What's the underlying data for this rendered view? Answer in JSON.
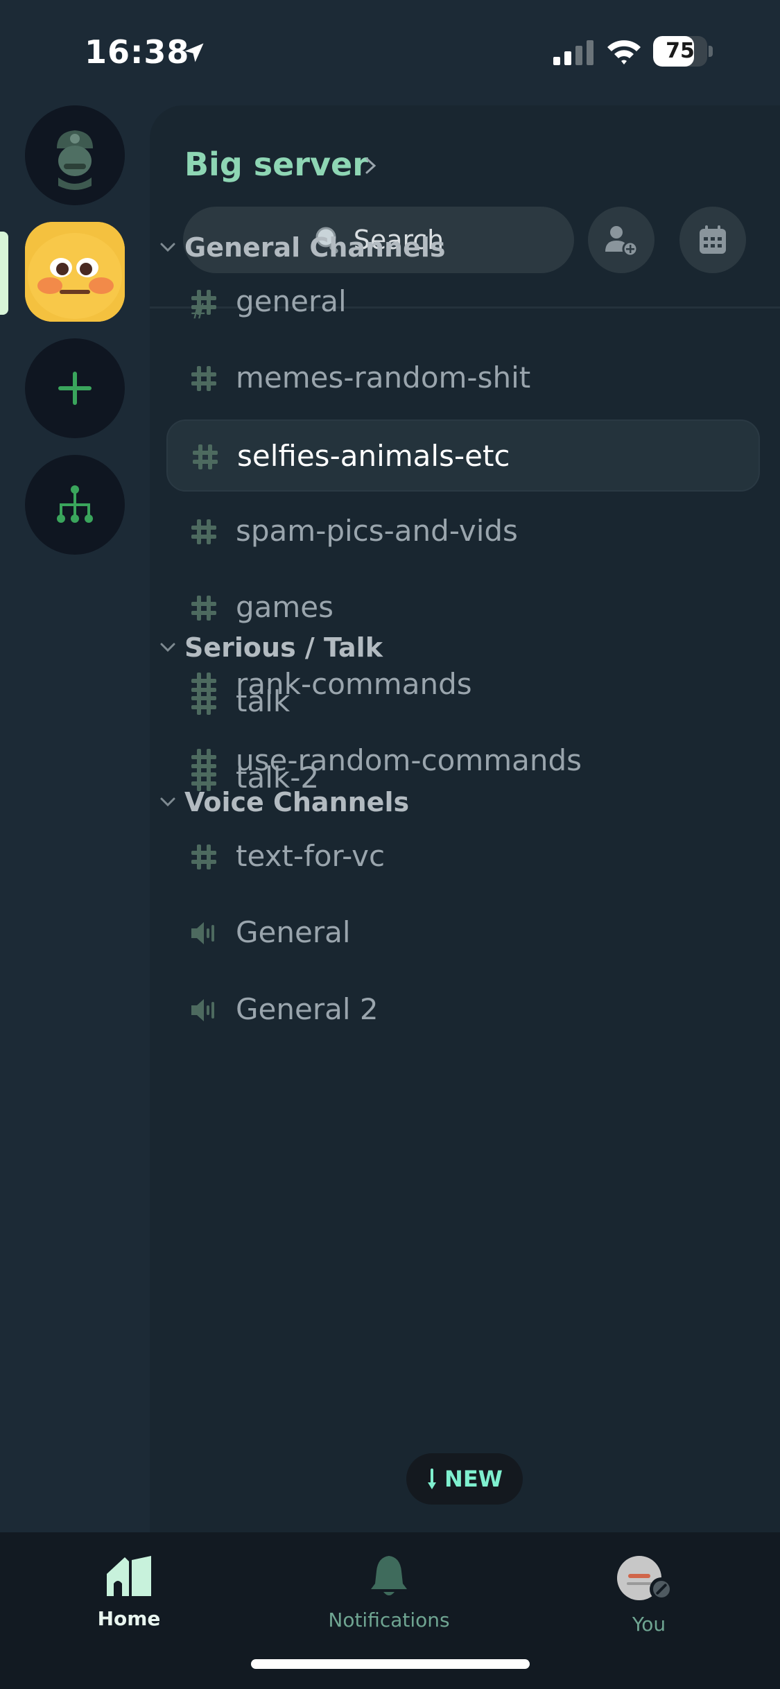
{
  "status_bar": {
    "time": "16:38",
    "battery": "75",
    "battery_level": 0.75
  },
  "server": {
    "name": "Big server",
    "search_placeholder": "Search"
  },
  "categories": [
    {
      "label": "General Channels",
      "channels": [
        {
          "name": "general",
          "type": "text",
          "selected": false
        },
        {
          "name": "memes-random-shit",
          "type": "text",
          "selected": false
        },
        {
          "name": "selfies-animals-etc",
          "type": "text",
          "selected": true
        },
        {
          "name": "spam-pics-and-vids",
          "type": "text",
          "selected": false
        },
        {
          "name": "games",
          "type": "text",
          "selected": false
        },
        {
          "name": "rank-commands",
          "type": "text",
          "selected": false
        },
        {
          "name": "use-random-commands",
          "type": "text",
          "selected": false
        }
      ]
    },
    {
      "label": "Serious / Talk",
      "channels": [
        {
          "name": "talk",
          "type": "text",
          "selected": false
        },
        {
          "name": "talk-2",
          "type": "text",
          "selected": false
        }
      ]
    },
    {
      "label": "Voice Channels",
      "channels": [
        {
          "name": "text-for-vc",
          "type": "text",
          "selected": false
        },
        {
          "name": "General",
          "type": "voice",
          "selected": false
        },
        {
          "name": "General 2",
          "type": "voice",
          "selected": false
        }
      ]
    }
  ],
  "new_badge": "NEW",
  "tabs": {
    "home": "Home",
    "notifications": "Notifications",
    "you": "You"
  },
  "colors": {
    "accent": "#8ed6b4",
    "hash_icon": "#4d6a5f",
    "rail_green": "#3aa55c"
  }
}
